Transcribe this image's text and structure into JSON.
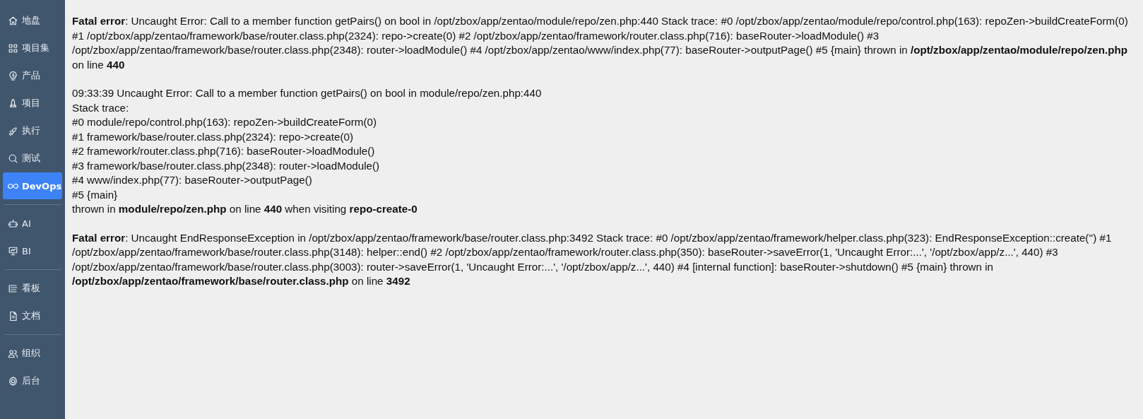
{
  "sidebar": {
    "groups": [
      {
        "items": [
          {
            "label": "地盘",
            "selected": false
          },
          {
            "label": "项目集",
            "selected": false
          },
          {
            "label": "产品",
            "selected": false
          },
          {
            "label": "项目",
            "selected": false
          },
          {
            "label": "执行",
            "selected": false
          },
          {
            "label": "测试",
            "selected": false
          },
          {
            "label": "DevOps",
            "selected": true
          }
        ]
      },
      {
        "items": [
          {
            "label": "AI",
            "selected": false
          },
          {
            "label": "BI",
            "selected": false
          }
        ]
      },
      {
        "items": [
          {
            "label": "看板",
            "selected": false
          },
          {
            "label": "文档",
            "selected": false
          }
        ]
      },
      {
        "items": [
          {
            "label": "组织",
            "selected": false
          },
          {
            "label": "后台",
            "selected": false
          }
        ]
      }
    ]
  },
  "errors": [
    {
      "kind": "paragraph",
      "text": "**Fatal error**: Uncaught Error: Call to a member function getPairs() on bool in /opt/zbox/app/zentao/module/repo/zen.php:440 Stack trace: #0 /opt/zbox/app/zentao/module/repo/control.php(163): repoZen->buildCreateForm(0) #1 /opt/zbox/app/zentao/framework/base/router.class.php(2324): repo->create(0) #2 /opt/zbox/app/zentao/framework/router.class.php(716): baseRouter->loadModule() #3 /opt/zbox/app/zentao/framework/base/router.class.php(2348): router->loadModule() #4 /opt/zbox/app/zentao/www/index.php(77): baseRouter->outputPage() #5 {main} thrown in **/opt/zbox/app/zentao/module/repo/zen.php** on line **440**"
    },
    {
      "kind": "lines",
      "lines": [
        "09:33:39 Uncaught Error: Call to a member function getPairs() on bool in module/repo/zen.php:440",
        "Stack trace:",
        "#0 module/repo/control.php(163): repoZen->buildCreateForm(0)",
        "#1 framework/base/router.class.php(2324): repo->create(0)",
        "#2 framework/router.class.php(716): baseRouter->loadModule()",
        "#3 framework/base/router.class.php(2348): router->loadModule()",
        "#4 www/index.php(77): baseRouter->outputPage()",
        "#5 {main}",
        "thrown in **module/repo/zen.php** on line **440** when visiting **repo-create-0**"
      ]
    },
    {
      "kind": "paragraph",
      "text": "**Fatal error**: Uncaught EndResponseException in /opt/zbox/app/zentao/framework/base/router.class.php:3492 Stack trace: #0 /opt/zbox/app/zentao/framework/helper.class.php(323): EndResponseException::create('') #1 /opt/zbox/app/zentao/framework/base/router.class.php(3148): helper::end() #2 /opt/zbox/app/zentao/framework/router.class.php(350): baseRouter->saveError(1, 'Uncaught Error:...', '/opt/zbox/app/z...', 440) #3 /opt/zbox/app/zentao/framework/base/router.class.php(3003): router->saveError(1, 'Uncaught Error:...', '/opt/zbox/app/z...', 440) #4 [internal function]: baseRouter->shutdown() #5 {main} thrown in **/opt/zbox/app/zentao/framework/base/router.class.php** on line **3492**"
    }
  ]
}
